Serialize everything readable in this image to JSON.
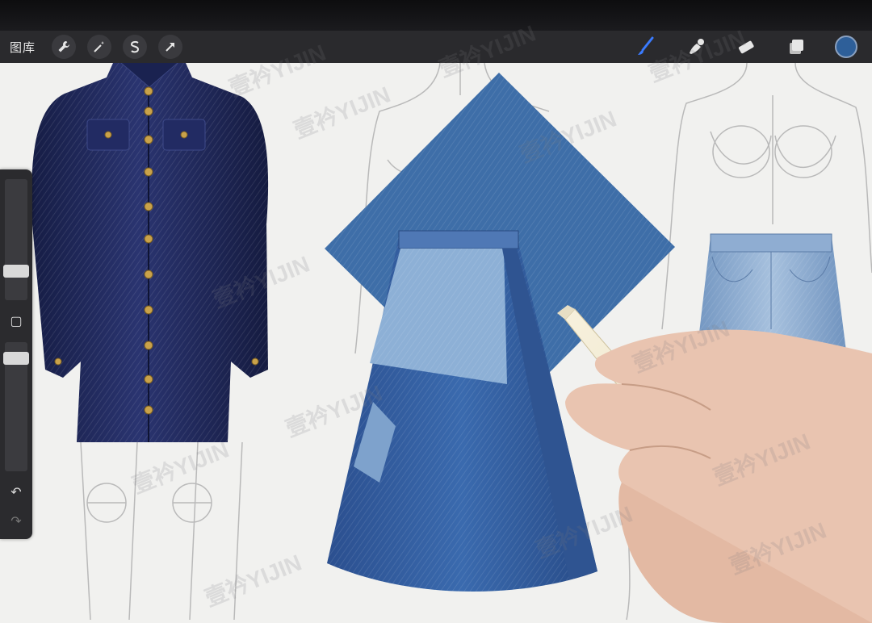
{
  "toolbar": {
    "gallery_label": "图库",
    "left_tools": [
      {
        "name": "wrench-icon",
        "glyph": "🔧"
      },
      {
        "name": "magic-wand-icon",
        "glyph": "✦"
      },
      {
        "name": "selection-icon",
        "glyph": "S"
      },
      {
        "name": "transform-arrow-icon",
        "glyph": "➚"
      }
    ],
    "right_tools": [
      "brush-icon",
      "smudge-icon",
      "eraser-icon",
      "layers-icon"
    ],
    "current_color": "#2e5f99"
  },
  "sidebar": {
    "undo_glyph": "↶",
    "redo_glyph": "↷",
    "modify_glyph": "▢"
  },
  "watermark": "壹衿YIJIN",
  "colors": {
    "denim_dark": "#1f2a5c",
    "denim_mid": "#2f5d9b",
    "denim_light": "#7fa6cf",
    "button_gold": "#c9a24a"
  }
}
